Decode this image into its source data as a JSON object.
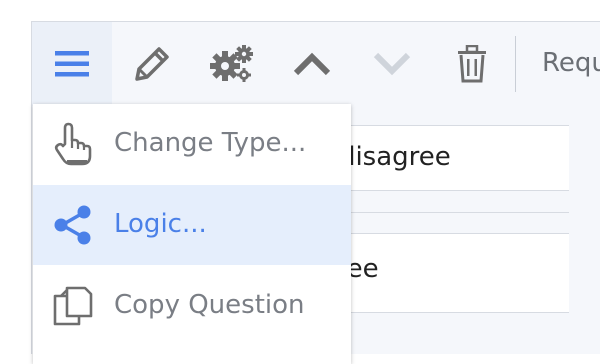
{
  "toolbar": {
    "required_label": "Requ"
  },
  "rows": [
    {
      "text": "r disagree"
    },
    {
      "text": "gree"
    }
  ],
  "menu": {
    "items": [
      {
        "label": "Change Type...",
        "icon": "hand-pointer-icon"
      },
      {
        "label": "Logic...",
        "icon": "share-icon"
      },
      {
        "label": "Copy Question",
        "icon": "copy-icon"
      }
    ],
    "selected_index": 1
  },
  "colors": {
    "accent": "#4a80e8",
    "icon_gray": "#6e6e6e",
    "disabled": "#cfd4db",
    "selected_bg": "#e5eefc"
  }
}
